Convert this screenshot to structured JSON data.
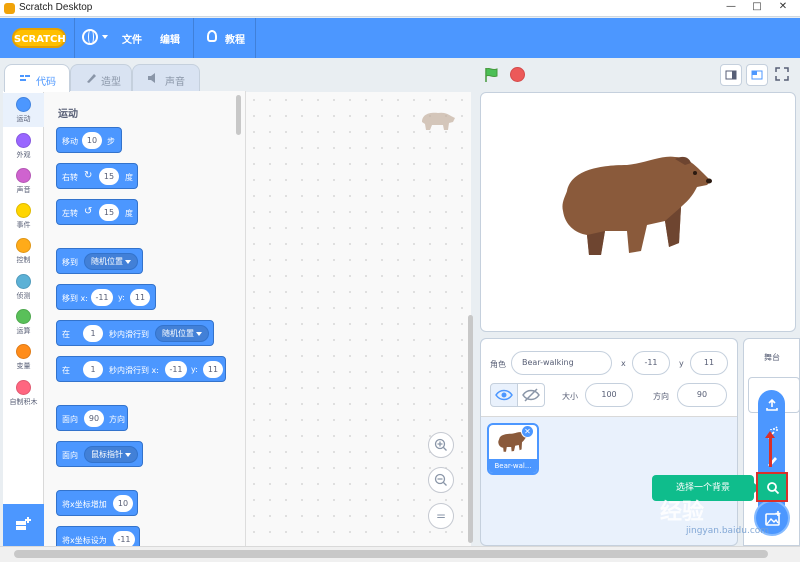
{
  "window": {
    "title": "Scratch Desktop",
    "minimize": "—",
    "maximize": "□",
    "close": "✕"
  },
  "menubar": {
    "logo": "SCRATCH",
    "file": "文件",
    "edit": "编辑",
    "tutorials": "教程"
  },
  "tabs": [
    {
      "label": "代码"
    },
    {
      "label": "造型"
    },
    {
      "label": "声音"
    }
  ],
  "categories": [
    {
      "label": "运动",
      "color": "#4c97ff"
    },
    {
      "label": "外观",
      "color": "#9966ff"
    },
    {
      "label": "声音",
      "color": "#cf63cf"
    },
    {
      "label": "事件",
      "color": "#ffd500"
    },
    {
      "label": "控制",
      "color": "#ffab19"
    },
    {
      "label": "侦测",
      "color": "#5cb1d6"
    },
    {
      "label": "运算",
      "color": "#59c059"
    },
    {
      "label": "变量",
      "color": "#ff8c1a"
    },
    {
      "label": "自制积木",
      "color": "#ff6680"
    }
  ],
  "palette": {
    "title": "运动",
    "blocks": {
      "move": {
        "a": "移动",
        "v": "10",
        "b": "步"
      },
      "turn_right": {
        "a": "右转",
        "v": "15",
        "b": "度"
      },
      "turn_left": {
        "a": "左转",
        "v": "15",
        "b": "度"
      },
      "goto": {
        "a": "移到",
        "d": "随机位置"
      },
      "goto_xy": {
        "a": "移到 x:",
        "x": "-11",
        "y_label": "y:",
        "y": "11"
      },
      "glide": {
        "a": "在",
        "v": "1",
        "b": "秒内滑行到",
        "d": "随机位置"
      },
      "glide_xy": {
        "a": "在",
        "v": "1",
        "b": "秒内滑行到 x:",
        "x": "-11",
        "y_label": "y:",
        "y": "11"
      },
      "point_dir": {
        "a": "面向",
        "v": "90",
        "b": "方向"
      },
      "point_towards": {
        "a": "面向",
        "d": "鼠标指针"
      },
      "change_x": {
        "a": "将x坐标增加",
        "v": "10"
      },
      "set_x": {
        "a": "将x坐标设为",
        "v": "-11"
      }
    }
  },
  "zoom": {
    "in": "+",
    "out": "−",
    "reset": "="
  },
  "sprite_info": {
    "sprite_label": "角色",
    "sprite_name": "Bear-walking",
    "x_label": "x",
    "x": "-11",
    "y_label": "y",
    "y": "11",
    "show_label": "显示",
    "size_label": "大小",
    "size": "100",
    "direction_label": "方向",
    "direction": "90"
  },
  "sprites": [
    {
      "name": "Bear-wal..."
    }
  ],
  "stage_panel": {
    "label": "舞台"
  },
  "tooltip": "选择一个背景",
  "watermark": {
    "main": "经验",
    "sub": "jingyan.baidu.com"
  },
  "colors": {
    "accent": "#4c97ff",
    "green": "#0fbd8c",
    "stop": "#ec5959",
    "highlight": "#d9302a"
  }
}
